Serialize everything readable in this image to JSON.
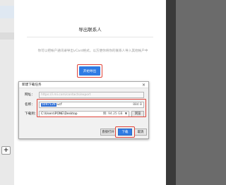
{
  "left_panel": {
    "plus_label": "+"
  },
  "main": {
    "title": "导出联系人",
    "description": "你可以把帐户通讯录导出vCard格式，以方便你将你的联系人导入其他帐户中",
    "start_button": "开始导出"
  },
  "dialog": {
    "title": "新建下载任务",
    "close_label": "×",
    "url_label": "网址：",
    "url_value": "https://i.mi.com/contacts/export",
    "name_label": "名称：",
    "name_selected": "5097126",
    "name_ext": ".vcf",
    "name_size": "884 B",
    "dir_label": "下载到：",
    "dir_value": "C:\\Users\\PONE\\Desktop",
    "dir_free": "剩: 94.25 GB",
    "browse_label": "浏览",
    "open_label": "直接打开",
    "download_label": "下载",
    "cancel_label": "取消"
  },
  "colors": {
    "accent": "#2f7be3",
    "highlight": "#e0443a"
  }
}
